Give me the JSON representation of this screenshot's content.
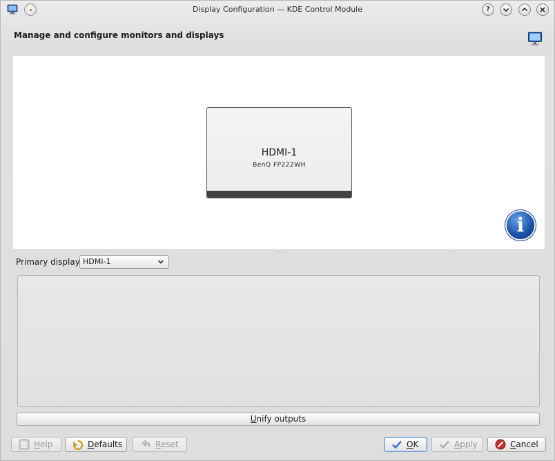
{
  "window": {
    "title": "Display Configuration — KDE Control Module",
    "app_icon": "monitor-icon",
    "buttons": {
      "help": "?",
      "minimize": "⌄",
      "maximize": "⌃",
      "close": "✕"
    }
  },
  "header": {
    "title": "Manage and configure monitors and displays",
    "icon": "display-icon"
  },
  "canvas": {
    "monitor": {
      "output_name": "HDMI-1",
      "model": "BenQ FP222WH"
    },
    "info_icon": "i",
    "splitter_handle": "..."
  },
  "primary_display": {
    "label": "Primary display:",
    "selected": "HDMI-1"
  },
  "unify_button": {
    "mnemonic": "U",
    "rest": "nify outputs"
  },
  "footer": {
    "help": {
      "mnemonic": "H",
      "rest": "elp",
      "enabled": false
    },
    "defaults": {
      "mnemonic": "D",
      "rest": "efaults",
      "enabled": true
    },
    "reset": {
      "mnemonic": "R",
      "rest": "eset",
      "enabled": false
    },
    "ok": {
      "mnemonic": "O",
      "rest": "K",
      "enabled": true
    },
    "apply": {
      "mnemonic": "A",
      "rest": "pply",
      "enabled": false
    },
    "cancel": {
      "mnemonic": "C",
      "rest": "ancel",
      "enabled": true
    }
  },
  "colors": {
    "accent": "#3a7bd5",
    "info_blue": "#1950a8",
    "cancel_red": "#c0312b"
  }
}
